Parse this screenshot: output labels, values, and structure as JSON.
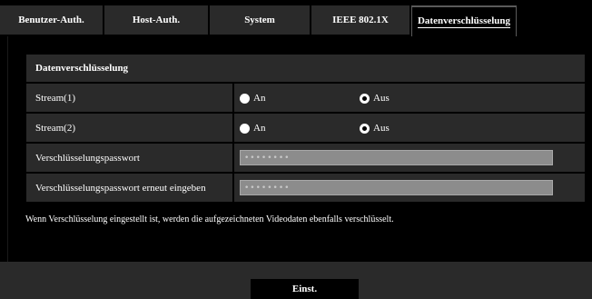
{
  "tabs": [
    {
      "label": "Benutzer-Auth.",
      "active": false
    },
    {
      "label": "Host-Auth.",
      "active": false
    },
    {
      "label": "System",
      "active": false
    },
    {
      "label": "IEEE 802.1X",
      "active": false
    },
    {
      "label": "Datenverschlüsselung",
      "active": true
    }
  ],
  "section": {
    "title": "Datenverschlüsselung",
    "stream1": {
      "label": "Stream(1)",
      "on_label": "An",
      "off_label": "Aus",
      "selected": "Aus"
    },
    "stream2": {
      "label": "Stream(2)",
      "on_label": "An",
      "off_label": "Aus",
      "selected": "Aus"
    },
    "password": {
      "label": "Verschlüsselungspasswort",
      "value": "••••••••"
    },
    "password_confirm": {
      "label": "Verschlüsselungspasswort erneut eingeben",
      "value": "••••••••"
    }
  },
  "note": "Wenn Verschlüsselung eingestellt ist, werden die aufgezeichneten Videodaten ebenfalls verschlüsselt.",
  "footer": {
    "submit_label": "Einst."
  },
  "colors": {
    "bg": "#000000",
    "panel": "#2a2a2a",
    "input": "#8c8c8c"
  }
}
